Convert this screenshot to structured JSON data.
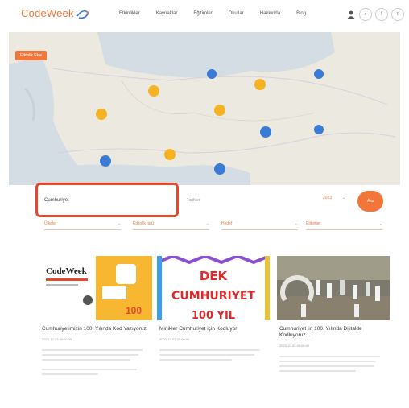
{
  "header": {
    "logo": "CodeWeek",
    "nav": [
      "Etkinlikler",
      "Kaynaklar",
      "Eğitimler",
      "Okullar",
      "Hakkında",
      "Blog"
    ],
    "icons": [
      "user-icon",
      "search-icon",
      "facebook-icon",
      "twitter-icon"
    ],
    "circle_labels": [
      "⌕",
      "f",
      "t"
    ]
  },
  "map": {
    "tag": "Etkinlik Ekle",
    "colors": {
      "cluster_blue": "#3a7bd5",
      "cluster_yellow": "#f5b324",
      "sea": "#d3dde3",
      "land": "#ece9e1"
    }
  },
  "search": {
    "value": "Cumhuriyet",
    "date_placeholder": "Tarihler",
    "year": "2023",
    "button": "Ara"
  },
  "filters": [
    "Ülkeler",
    "Etkinlik türü",
    "Hedef",
    "Etiketler"
  ],
  "cards": [
    {
      "title": "Cumhuriyetimizin 100. Yılında Kod Yazıyoruz",
      "date": "2023-10-03 00:00:00",
      "img_texts": {
        "brand": "CodeWeek",
        "badge": "100"
      }
    },
    {
      "title": "Minikler Cumhuriyet için Kodluyor",
      "date": "2023-10-03 00:00:00",
      "img_texts": {
        "line1": "DEK",
        "line2": "CUMHURIYET",
        "line3": "100 YIL"
      }
    },
    {
      "title": "Cumhuriyet 'in 100. Yılında Dijitalde Kodluyoruz...",
      "date": "2023-10-05 00:00:00",
      "img_texts": {}
    }
  ]
}
